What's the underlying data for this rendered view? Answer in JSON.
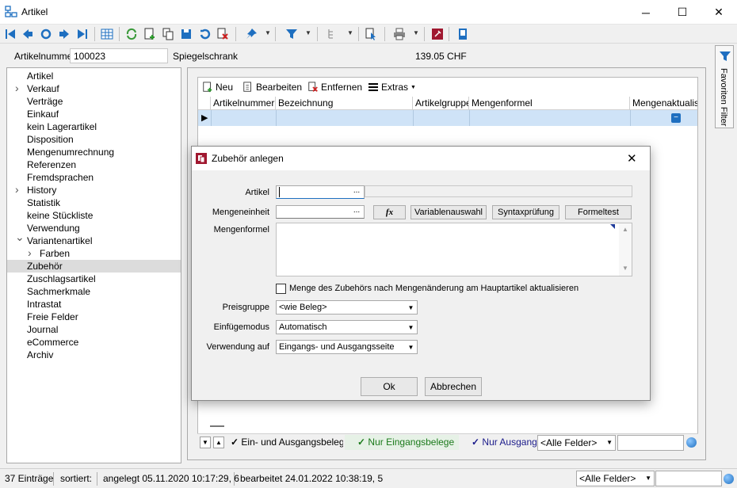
{
  "window": {
    "title": "Artikel",
    "minimize": "─",
    "maximize": "☐",
    "close": "✕"
  },
  "header": {
    "artikelnummer_label": "Artikelnummer",
    "artikelnummer_value": "100023",
    "artikel_name": "Spiegelschrank",
    "price": "139.05  CHF"
  },
  "tree": {
    "items": [
      {
        "label": "Artikel",
        "expandable": false
      },
      {
        "label": "Verkauf",
        "expandable": true
      },
      {
        "label": "Verträge",
        "expandable": false
      },
      {
        "label": "Einkauf",
        "expandable": false
      },
      {
        "label": "kein Lagerartikel",
        "expandable": false
      },
      {
        "label": "Disposition",
        "expandable": false
      },
      {
        "label": "Mengenumrechnung",
        "expandable": false
      },
      {
        "label": "Referenzen",
        "expandable": false
      },
      {
        "label": "Fremdsprachen",
        "expandable": false
      },
      {
        "label": "History",
        "expandable": true
      },
      {
        "label": "Statistik",
        "expandable": false
      },
      {
        "label": "keine Stückliste",
        "expandable": false
      },
      {
        "label": "Verwendung",
        "expandable": false
      },
      {
        "label": "Variantenartikel",
        "expanded": true
      },
      {
        "label": "Farben",
        "expandable": true,
        "child": true
      },
      {
        "label": "Zubehör",
        "selected": true
      },
      {
        "label": "Zuschlagsartikel"
      },
      {
        "label": "Sachmerkmale"
      },
      {
        "label": "Intrastat"
      },
      {
        "label": "Freie Felder"
      },
      {
        "label": "Journal"
      },
      {
        "label": "eCommerce"
      },
      {
        "label": "Archiv"
      }
    ]
  },
  "grid_toolbar": {
    "neu": "Neu",
    "bearbeiten": "Bearbeiten",
    "entfernen": "Entfernen",
    "extras": "Extras"
  },
  "grid": {
    "columns": [
      "Artikelnummer",
      "Bezeichnung",
      "Artikelgruppe",
      "Mengenformel",
      "Mengenaktualisierung"
    ]
  },
  "side_tab": {
    "label": "Favoriten Filter"
  },
  "filterbar": {
    "chip1": "Ein- und Ausgangsbelege",
    "chip2": "Nur Eingangsbelege",
    "chip3": "Nur Ausgangsbelege",
    "field_select": "<Alle Felder>"
  },
  "statusbar": {
    "count": "37 Einträge",
    "sorted": "sortiert:",
    "created": "angelegt 05.11.2020 10:17:29,  6",
    "edited": "bearbeitet 24.01.2022 10:38:19,  5",
    "field_select": "<Alle Felder>"
  },
  "dialog": {
    "title": "Zubehör anlegen",
    "artikel_label": "Artikel",
    "mengeneinheit_label": "Mengeneinheit",
    "mengenformel_label": "Mengenformel",
    "fx_label": "fx",
    "variablenauswahl": "Variablenauswahl",
    "syntaxpruefung": "Syntaxprüfung",
    "formeltest": "Formeltest",
    "checkbox_label": "Menge des Zubehörs nach Mengenänderung am Hauptartikel aktualisieren",
    "checkbox_checked": false,
    "preisgruppe_label": "Preisgruppe",
    "preisgruppe_value": "<wie Beleg>",
    "einfuegemodus_label": "Einfügemodus",
    "einfuegemodus_value": "Automatisch",
    "verwendung_label": "Verwendung auf",
    "verwendung_value": "Eingangs- und Ausgangsseite",
    "ok": "Ok",
    "abbrechen": "Abbrechen"
  },
  "colors": {
    "accent": "#1e6fc0",
    "selection_row": "#cfe3f7",
    "tree_selected": "#dcdcdc"
  }
}
